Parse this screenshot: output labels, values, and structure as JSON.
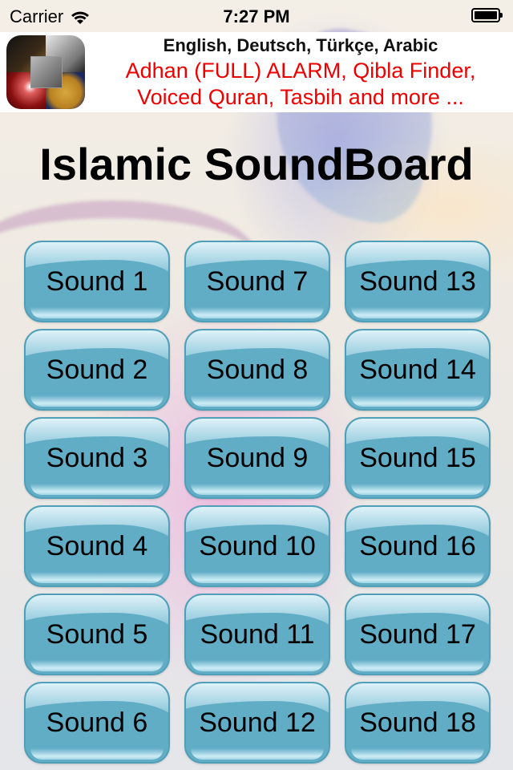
{
  "status_bar": {
    "carrier": "Carrier",
    "time": "7:27 PM",
    "wifi_icon": "wifi-icon",
    "battery_icon": "battery-full-icon"
  },
  "ad_banner": {
    "icon": "app-collage-icon",
    "line1": "English, Deutsch, Türkçe, Arabic",
    "line2": "Adhan (FULL) ALARM, Qibla Finder,",
    "line3": "Voiced Quran, Tasbih and more ...",
    "line1_color": "#111111",
    "highlight_color": "#ee0000"
  },
  "title": "Islamic SoundBoard",
  "colors": {
    "button_fill": "#62adc6",
    "button_border": "#4f9fb9",
    "text": "#000000"
  },
  "sounds": [
    {
      "label": "Sound 1"
    },
    {
      "label": "Sound 2"
    },
    {
      "label": "Sound 3"
    },
    {
      "label": "Sound 4"
    },
    {
      "label": "Sound 5"
    },
    {
      "label": "Sound 6"
    },
    {
      "label": "Sound 7"
    },
    {
      "label": "Sound 8"
    },
    {
      "label": "Sound 9"
    },
    {
      "label": "Sound 10"
    },
    {
      "label": "Sound 11"
    },
    {
      "label": "Sound 12"
    },
    {
      "label": "Sound 13"
    },
    {
      "label": "Sound 14"
    },
    {
      "label": "Sound 15"
    },
    {
      "label": "Sound 16"
    },
    {
      "label": "Sound 17"
    },
    {
      "label": "Sound 18"
    }
  ]
}
